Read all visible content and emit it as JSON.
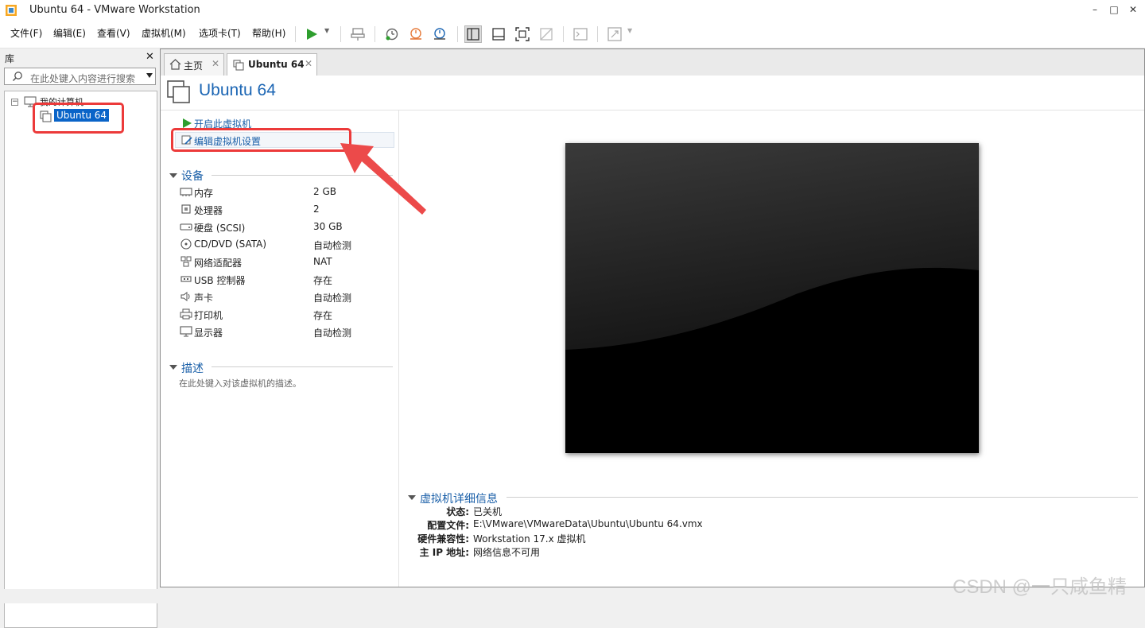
{
  "window": {
    "title": "Ubuntu 64  - VMware Workstation",
    "min": "–",
    "max": "□",
    "close": "✕"
  },
  "menu": [
    "文件(F)",
    "编辑(E)",
    "查看(V)",
    "虚拟机(M)",
    "选项卡(T)",
    "帮助(H)"
  ],
  "library": {
    "title": "库",
    "close": "✕",
    "search_placeholder": "在此处键入内容进行搜索",
    "root": "我的计算机",
    "root_toggle": "⊟",
    "vm": "Ubuntu 64"
  },
  "tabs": [
    {
      "label": "主页",
      "close": "✕"
    },
    {
      "label": "Ubuntu 64",
      "close": "✕"
    }
  ],
  "vm": {
    "title": "Ubuntu 64",
    "actions": {
      "power_on": "开启此虚拟机",
      "edit_settings": "编辑虚拟机设置"
    },
    "devices_title": "设备",
    "devices": [
      {
        "name": "内存",
        "value": "2 GB",
        "icon": "memory-icon"
      },
      {
        "name": "处理器",
        "value": "2",
        "icon": "cpu-icon"
      },
      {
        "name": "硬盘 (SCSI)",
        "value": "30 GB",
        "icon": "disk-icon"
      },
      {
        "name": "CD/DVD (SATA)",
        "value": "自动检测",
        "icon": "cd-icon"
      },
      {
        "name": "网络适配器",
        "value": "NAT",
        "icon": "network-icon"
      },
      {
        "name": "USB 控制器",
        "value": "存在",
        "icon": "usb-icon"
      },
      {
        "name": "声卡",
        "value": "自动检测",
        "icon": "sound-icon"
      },
      {
        "name": "打印机",
        "value": "存在",
        "icon": "printer-icon"
      },
      {
        "name": "显示器",
        "value": "自动检测",
        "icon": "display-icon"
      }
    ],
    "description_title": "描述",
    "description_placeholder": "在此处键入对该虚拟机的描述。",
    "details_title": "虚拟机详细信息",
    "details": [
      {
        "label": "状态:",
        "value": "已关机"
      },
      {
        "label": "配置文件:",
        "value": "E:\\VMware\\VMwareData\\Ubuntu\\Ubuntu 64.vmx"
      },
      {
        "label": "硬件兼容性:",
        "value": "Workstation 17.x 虚拟机"
      },
      {
        "label": "主 IP 地址:",
        "value": "网络信息不可用"
      }
    ]
  },
  "watermark": "CSDN @一只咸鱼精",
  "colors": {
    "accent": "#1c66b4",
    "selection": "#0a64c8",
    "highlight": "#ec3a3a",
    "play": "#2e9e2e"
  }
}
